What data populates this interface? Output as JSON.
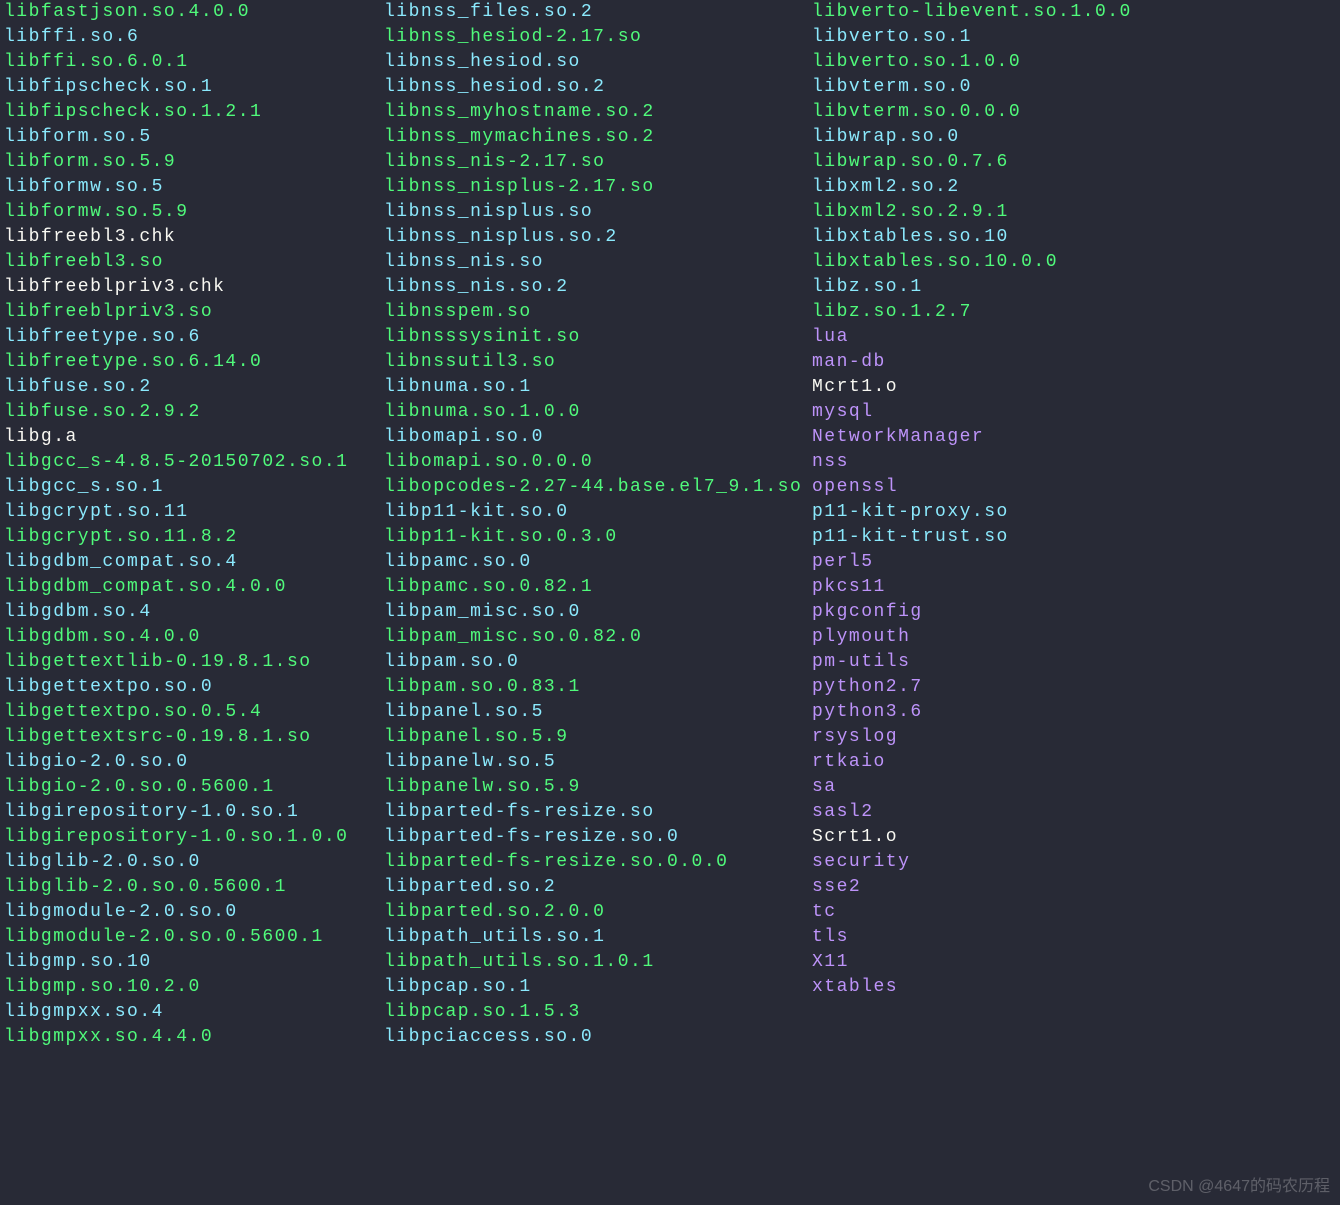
{
  "watermark": "CSDN @4647的码农历程",
  "columns": [
    [
      {
        "name": "libfastjson.so.4.0.0",
        "cls": "green"
      },
      {
        "name": "libffi.so.6",
        "cls": "cyan"
      },
      {
        "name": "libffi.so.6.0.1",
        "cls": "green"
      },
      {
        "name": "libfipscheck.so.1",
        "cls": "cyan"
      },
      {
        "name": "libfipscheck.so.1.2.1",
        "cls": "green"
      },
      {
        "name": "libform.so.5",
        "cls": "cyan"
      },
      {
        "name": "libform.so.5.9",
        "cls": "green"
      },
      {
        "name": "libformw.so.5",
        "cls": "cyan"
      },
      {
        "name": "libformw.so.5.9",
        "cls": "green"
      },
      {
        "name": "libfreebl3.chk",
        "cls": "white"
      },
      {
        "name": "libfreebl3.so",
        "cls": "green"
      },
      {
        "name": "libfreeblpriv3.chk",
        "cls": "white"
      },
      {
        "name": "libfreeblpriv3.so",
        "cls": "green"
      },
      {
        "name": "libfreetype.so.6",
        "cls": "cyan"
      },
      {
        "name": "libfreetype.so.6.14.0",
        "cls": "green"
      },
      {
        "name": "libfuse.so.2",
        "cls": "cyan"
      },
      {
        "name": "libfuse.so.2.9.2",
        "cls": "green"
      },
      {
        "name": "libg.a",
        "cls": "white"
      },
      {
        "name": "libgcc_s-4.8.5-20150702.so.1",
        "cls": "green"
      },
      {
        "name": "libgcc_s.so.1",
        "cls": "cyan"
      },
      {
        "name": "libgcrypt.so.11",
        "cls": "cyan"
      },
      {
        "name": "libgcrypt.so.11.8.2",
        "cls": "green"
      },
      {
        "name": "libgdbm_compat.so.4",
        "cls": "cyan"
      },
      {
        "name": "libgdbm_compat.so.4.0.0",
        "cls": "green"
      },
      {
        "name": "libgdbm.so.4",
        "cls": "cyan"
      },
      {
        "name": "libgdbm.so.4.0.0",
        "cls": "green"
      },
      {
        "name": "libgettextlib-0.19.8.1.so",
        "cls": "green"
      },
      {
        "name": "libgettextpo.so.0",
        "cls": "cyan"
      },
      {
        "name": "libgettextpo.so.0.5.4",
        "cls": "green"
      },
      {
        "name": "libgettextsrc-0.19.8.1.so",
        "cls": "green"
      },
      {
        "name": "libgio-2.0.so.0",
        "cls": "cyan"
      },
      {
        "name": "libgio-2.0.so.0.5600.1",
        "cls": "green"
      },
      {
        "name": "libgirepository-1.0.so.1",
        "cls": "cyan"
      },
      {
        "name": "libgirepository-1.0.so.1.0.0",
        "cls": "green"
      },
      {
        "name": "libglib-2.0.so.0",
        "cls": "cyan"
      },
      {
        "name": "libglib-2.0.so.0.5600.1",
        "cls": "green"
      },
      {
        "name": "libgmodule-2.0.so.0",
        "cls": "cyan"
      },
      {
        "name": "libgmodule-2.0.so.0.5600.1",
        "cls": "green"
      },
      {
        "name": "libgmp.so.10",
        "cls": "cyan"
      },
      {
        "name": "libgmp.so.10.2.0",
        "cls": "green"
      },
      {
        "name": "libgmpxx.so.4",
        "cls": "cyan"
      },
      {
        "name": "libgmpxx.so.4.4.0",
        "cls": "green"
      }
    ],
    [
      {
        "name": "libnss_files.so.2",
        "cls": "cyan"
      },
      {
        "name": "libnss_hesiod-2.17.so",
        "cls": "green"
      },
      {
        "name": "libnss_hesiod.so",
        "cls": "cyan"
      },
      {
        "name": "libnss_hesiod.so.2",
        "cls": "cyan"
      },
      {
        "name": "libnss_myhostname.so.2",
        "cls": "green"
      },
      {
        "name": "libnss_mymachines.so.2",
        "cls": "green"
      },
      {
        "name": "libnss_nis-2.17.so",
        "cls": "green"
      },
      {
        "name": "libnss_nisplus-2.17.so",
        "cls": "green"
      },
      {
        "name": "libnss_nisplus.so",
        "cls": "cyan"
      },
      {
        "name": "libnss_nisplus.so.2",
        "cls": "cyan"
      },
      {
        "name": "libnss_nis.so",
        "cls": "cyan"
      },
      {
        "name": "libnss_nis.so.2",
        "cls": "cyan"
      },
      {
        "name": "libnsspem.so",
        "cls": "green"
      },
      {
        "name": "libnsssysinit.so",
        "cls": "green"
      },
      {
        "name": "libnssutil3.so",
        "cls": "green"
      },
      {
        "name": "libnuma.so.1",
        "cls": "cyan"
      },
      {
        "name": "libnuma.so.1.0.0",
        "cls": "green"
      },
      {
        "name": "libomapi.so.0",
        "cls": "cyan"
      },
      {
        "name": "libomapi.so.0.0.0",
        "cls": "green"
      },
      {
        "name": "libopcodes-2.27-44.base.el7_9.1.so",
        "cls": "green"
      },
      {
        "name": "libp11-kit.so.0",
        "cls": "cyan"
      },
      {
        "name": "libp11-kit.so.0.3.0",
        "cls": "green"
      },
      {
        "name": "libpamc.so.0",
        "cls": "cyan"
      },
      {
        "name": "libpamc.so.0.82.1",
        "cls": "green"
      },
      {
        "name": "libpam_misc.so.0",
        "cls": "cyan"
      },
      {
        "name": "libpam_misc.so.0.82.0",
        "cls": "green"
      },
      {
        "name": "libpam.so.0",
        "cls": "cyan"
      },
      {
        "name": "libpam.so.0.83.1",
        "cls": "green"
      },
      {
        "name": "libpanel.so.5",
        "cls": "cyan"
      },
      {
        "name": "libpanel.so.5.9",
        "cls": "green"
      },
      {
        "name": "libpanelw.so.5",
        "cls": "cyan"
      },
      {
        "name": "libpanelw.so.5.9",
        "cls": "green"
      },
      {
        "name": "libparted-fs-resize.so",
        "cls": "cyan"
      },
      {
        "name": "libparted-fs-resize.so.0",
        "cls": "cyan"
      },
      {
        "name": "libparted-fs-resize.so.0.0.0",
        "cls": "green"
      },
      {
        "name": "libparted.so.2",
        "cls": "cyan"
      },
      {
        "name": "libparted.so.2.0.0",
        "cls": "green"
      },
      {
        "name": "libpath_utils.so.1",
        "cls": "cyan"
      },
      {
        "name": "libpath_utils.so.1.0.1",
        "cls": "green"
      },
      {
        "name": "libpcap.so.1",
        "cls": "cyan"
      },
      {
        "name": "libpcap.so.1.5.3",
        "cls": "green"
      },
      {
        "name": "libpciaccess.so.0",
        "cls": "cyan"
      }
    ],
    [
      {
        "name": "libverto-libevent.so.1.0.0",
        "cls": "green"
      },
      {
        "name": "libverto.so.1",
        "cls": "cyan"
      },
      {
        "name": "libverto.so.1.0.0",
        "cls": "green"
      },
      {
        "name": "libvterm.so.0",
        "cls": "cyan"
      },
      {
        "name": "libvterm.so.0.0.0",
        "cls": "green"
      },
      {
        "name": "libwrap.so.0",
        "cls": "cyan"
      },
      {
        "name": "libwrap.so.0.7.6",
        "cls": "green"
      },
      {
        "name": "libxml2.so.2",
        "cls": "cyan"
      },
      {
        "name": "libxml2.so.2.9.1",
        "cls": "green"
      },
      {
        "name": "libxtables.so.10",
        "cls": "cyan"
      },
      {
        "name": "libxtables.so.10.0.0",
        "cls": "green"
      },
      {
        "name": "libz.so.1",
        "cls": "cyan"
      },
      {
        "name": "libz.so.1.2.7",
        "cls": "green"
      },
      {
        "name": "lua",
        "cls": "purple"
      },
      {
        "name": "man-db",
        "cls": "purple"
      },
      {
        "name": "Mcrt1.o",
        "cls": "white"
      },
      {
        "name": "mysql",
        "cls": "purple"
      },
      {
        "name": "NetworkManager",
        "cls": "purple"
      },
      {
        "name": "nss",
        "cls": "purple"
      },
      {
        "name": "openssl",
        "cls": "purple"
      },
      {
        "name": "p11-kit-proxy.so",
        "cls": "cyan"
      },
      {
        "name": "p11-kit-trust.so",
        "cls": "cyan"
      },
      {
        "name": "perl5",
        "cls": "purple"
      },
      {
        "name": "pkcs11",
        "cls": "purple"
      },
      {
        "name": "pkgconfig",
        "cls": "purple"
      },
      {
        "name": "plymouth",
        "cls": "purple"
      },
      {
        "name": "pm-utils",
        "cls": "purple"
      },
      {
        "name": "python2.7",
        "cls": "purple"
      },
      {
        "name": "python3.6",
        "cls": "purple"
      },
      {
        "name": "rsyslog",
        "cls": "purple"
      },
      {
        "name": "rtkaio",
        "cls": "purple"
      },
      {
        "name": "sa",
        "cls": "purple"
      },
      {
        "name": "sasl2",
        "cls": "purple"
      },
      {
        "name": "Scrt1.o",
        "cls": "white"
      },
      {
        "name": "security",
        "cls": "purple"
      },
      {
        "name": "sse2",
        "cls": "purple"
      },
      {
        "name": "tc",
        "cls": "purple"
      },
      {
        "name": "tls",
        "cls": "purple"
      },
      {
        "name": "X11",
        "cls": "purple"
      },
      {
        "name": "xtables",
        "cls": "purple"
      }
    ]
  ]
}
